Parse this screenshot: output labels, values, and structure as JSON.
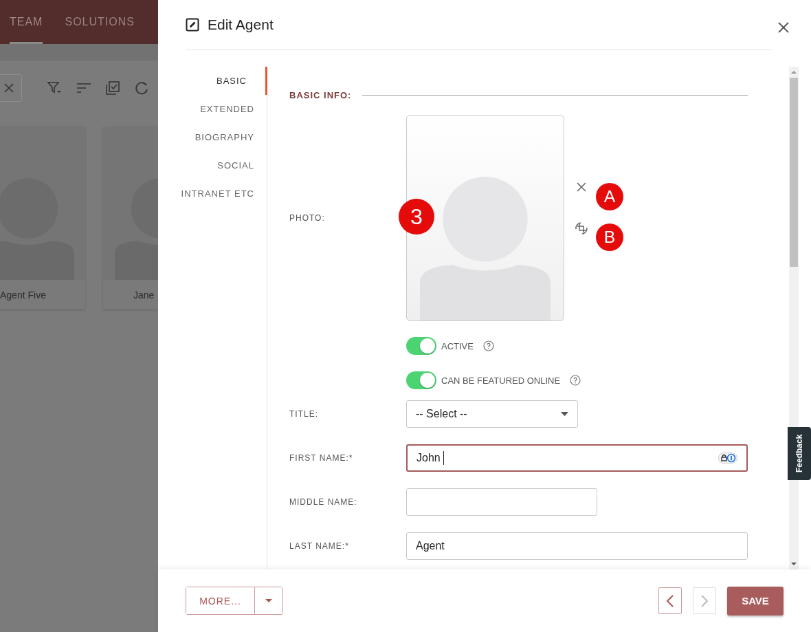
{
  "app": {
    "nav_tabs": [
      {
        "label": "TEAM",
        "selected": true
      },
      {
        "label": "SOLUTIONS",
        "selected": false
      }
    ],
    "cards": [
      {
        "name": "Agent Five"
      },
      {
        "name": "Jane"
      }
    ]
  },
  "dialog": {
    "title": "Edit Agent",
    "sections": [
      {
        "label": "BASIC",
        "selected": true
      },
      {
        "label": "EXTENDED",
        "selected": false
      },
      {
        "label": "BIOGRAPHY",
        "selected": false
      },
      {
        "label": "SOCIAL",
        "selected": false
      },
      {
        "label": "INTRANET ETC",
        "selected": false
      }
    ],
    "section_heading": "BASIC INFO:",
    "photo_label": "PHOTO:",
    "toggles": [
      {
        "label": "ACTIVE",
        "on": true
      },
      {
        "label": "CAN BE FEATURED ONLINE",
        "on": true
      }
    ],
    "fields": [
      {
        "kind": "select",
        "label": "TITLE:",
        "value": "-- Select --",
        "focused": false
      },
      {
        "kind": "text",
        "label": "FIRST NAME:*",
        "value": "John",
        "focused": true
      },
      {
        "kind": "text",
        "label": "MIDDLE NAME:",
        "focused": false
      },
      {
        "kind": "text",
        "label": "LAST NAME:*",
        "value": "Agent",
        "focused": false
      }
    ]
  },
  "annotations": [
    {
      "label": "3"
    },
    {
      "label": "A"
    },
    {
      "label": "B"
    }
  ],
  "footer": {
    "more": "MORE...",
    "save": "SAVE",
    "prev_disabled": false,
    "next_disabled": true
  },
  "feedback": "Feedback"
}
